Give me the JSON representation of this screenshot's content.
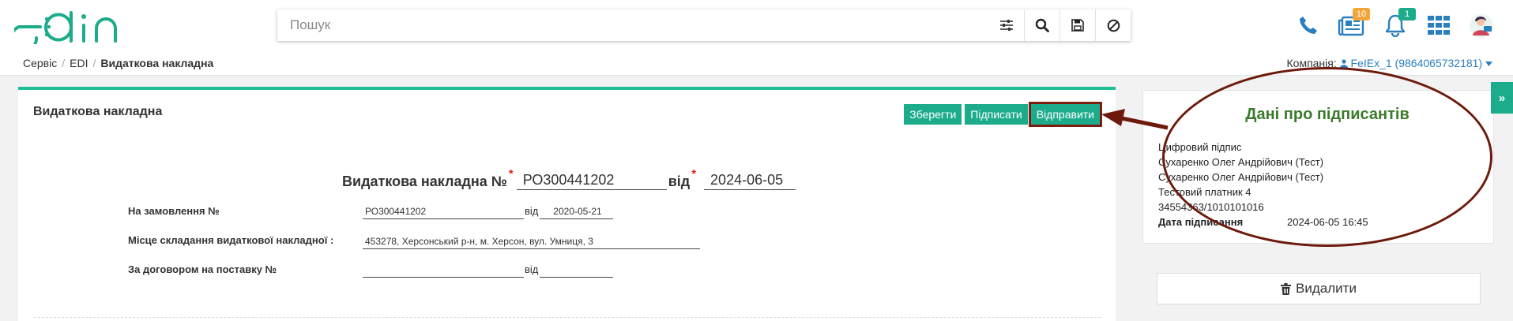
{
  "app": {
    "logo_text": "edin"
  },
  "search": {
    "placeholder": "Пошук"
  },
  "header": {
    "documents_badge": "10",
    "notifications_badge": "1"
  },
  "breadcrumbs": [
    "Сервіс",
    "EDI",
    "Видаткова накладна"
  ],
  "company": {
    "label": "Компанія:",
    "value": "FeIEx_1 (9864065732181)"
  },
  "document": {
    "panel_title": "Видаткова накладна",
    "buttons": {
      "save": "Зберегти",
      "sign": "Підписати",
      "send": "Відправити"
    },
    "heading_label": "Видаткова накладна №",
    "number": "РО300441202",
    "from_label": "від",
    "date": "2024-06-05",
    "order_label": "На замовлення №",
    "order_number": "РО300441202",
    "order_from_label": "від",
    "order_date": "2020-05-21",
    "place_label": "Місце складання видаткової накладної :",
    "place_value": "453278, Херсонський р-н, м. Херсон, вул. Умниця, 3",
    "contract_label": "За договором на поставку №",
    "contract_number": "",
    "contract_from_label": "від",
    "contract_date": ""
  },
  "signers": {
    "title": "Дані про підписантів",
    "lines": [
      "Цифровий підпис",
      "Сухаренко Олег Андрійович (Тест)",
      "Сухаренко Олег Андрійович (Тест)",
      "Тестовий платник 4",
      "34554363/1010101016"
    ],
    "date_label": "Дата підписання",
    "date_value": "2024-06-05 16:45"
  },
  "actions": {
    "delete": "Видалити"
  },
  "colors": {
    "brand": "#1cac8b",
    "highlight": "#7c1e0f",
    "title_green": "#3b7a2c",
    "link": "#2a7fbf"
  }
}
